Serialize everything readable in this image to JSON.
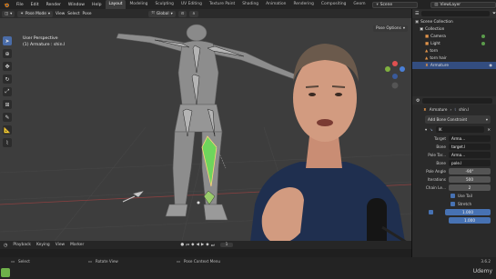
{
  "menubar": {
    "menus": [
      "File",
      "Edit",
      "Render",
      "Window",
      "Help"
    ],
    "workspaces": [
      {
        "label": "Layout",
        "active": true
      },
      {
        "label": "Modeling",
        "active": false
      },
      {
        "label": "Sculpting",
        "active": false
      },
      {
        "label": "UV Editing",
        "active": false
      },
      {
        "label": "Texture Paint",
        "active": false
      },
      {
        "label": "Shading",
        "active": false
      },
      {
        "label": "Animation",
        "active": false
      },
      {
        "label": "Rendering",
        "active": false
      },
      {
        "label": "Compositing",
        "active": false
      },
      {
        "label": "Geom",
        "active": false
      }
    ],
    "scene": "Scene",
    "view_layer": "ViewLayer"
  },
  "viewport_header": {
    "mode": "Pose Mode",
    "menus": [
      "View",
      "Select",
      "Pose"
    ],
    "orientation": "Global",
    "pose_options": "Pose Options"
  },
  "viewport": {
    "view_name": "User Perspective",
    "selection": "(1) Armature : shin.l"
  },
  "outliner": {
    "rows": [
      {
        "label": "Scene Collection",
        "icon": "collection-icon",
        "selected": false
      },
      {
        "label": "Collection",
        "icon": "collection-icon",
        "selected": false
      },
      {
        "label": "Camera",
        "icon": "camera-icon",
        "selected": false
      },
      {
        "label": "Light",
        "icon": "light-icon",
        "selected": false
      },
      {
        "label": "torn",
        "icon": "mesh-icon",
        "selected": false
      },
      {
        "label": "torn hair",
        "icon": "mesh-icon",
        "selected": false
      },
      {
        "label": "Armature",
        "icon": "armature-icon",
        "selected": true
      }
    ]
  },
  "properties": {
    "breadcrumb": {
      "object": "Armature",
      "bone": "shin.l"
    },
    "add_constraint": "Add Bone Constraint",
    "constraint_name": "IK",
    "fields": {
      "target_label": "Target",
      "target_value": "Arma...",
      "bone_label": "Bone",
      "bone_value": "target.l",
      "pole_target_label": "Pole Tar...",
      "pole_target_value": "Arma...",
      "pole_bone_label": "Bone",
      "pole_bone_value": "pole.l",
      "pole_angle_label": "Pole Angle",
      "pole_angle_value": "-90°",
      "iterations_label": "Iterations",
      "iterations_value": "500",
      "chain_label": "Chain Le...",
      "chain_value": "2",
      "use_tail": "Use Tail",
      "stretch": "Stretch",
      "weight_value": "1.000",
      "influence_value": "1.000"
    }
  },
  "timeline": {
    "menus": [
      "Playback",
      "Keying",
      "View",
      "Marker"
    ],
    "frame": "1"
  },
  "statusbar": {
    "select": "Select",
    "rotate": "Rotate View",
    "context": "Pose Context Menu",
    "version": "3.6.2",
    "watermark": "Udemy"
  },
  "colors": {
    "accent": "#4772b3",
    "header_bg": "#2b2b2b",
    "viewport_bg": "#3d3d3d",
    "bone_green": "#6fd55c"
  }
}
